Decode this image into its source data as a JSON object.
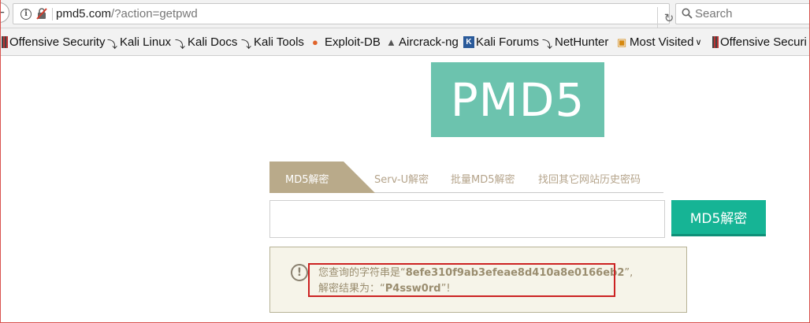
{
  "browser": {
    "url_host": "pmd5.com",
    "url_path": "/?action=getpwd",
    "search_placeholder": "Search"
  },
  "bookmarks": [
    {
      "label": "Offensive Security",
      "icon": "offsec-icon"
    },
    {
      "label": "Kali Linux",
      "icon": "kali-icon"
    },
    {
      "label": "Kali Docs",
      "icon": "kali-icon"
    },
    {
      "label": "Kali Tools",
      "icon": "kali-icon"
    },
    {
      "label": "Exploit-DB",
      "icon": "exploit-db-icon"
    },
    {
      "label": "Aircrack-ng",
      "icon": "aircrack-icon"
    },
    {
      "label": "Kali Forums",
      "icon": "kali-forums-icon"
    },
    {
      "label": "NetHunter",
      "icon": "kali-icon"
    },
    {
      "label": "Most Visited",
      "icon": "folder-icon"
    },
    {
      "label": "Offensive Securi",
      "icon": "offsec-icon"
    }
  ],
  "logo": {
    "text": "PMD5",
    "color": "#6cc3ae"
  },
  "tabs": [
    {
      "label": "MD5解密",
      "active": true
    },
    {
      "label": "Serv-U解密",
      "active": false
    },
    {
      "label": "批量MD5解密",
      "active": false
    },
    {
      "label": "找回其它网站历史密码",
      "active": false
    }
  ],
  "form": {
    "input_value": "",
    "button_label": "MD5解密",
    "button_color": "#16b495"
  },
  "result": {
    "line1_prefix": "您查询的字符串是“",
    "hash": "8efe310f9ab3efeae8d410a8e0166eb2",
    "line1_suffix": "”,",
    "line2_prefix": "解密结果为：“",
    "password": "P4ssw0rd",
    "line2_suffix": "”!"
  }
}
